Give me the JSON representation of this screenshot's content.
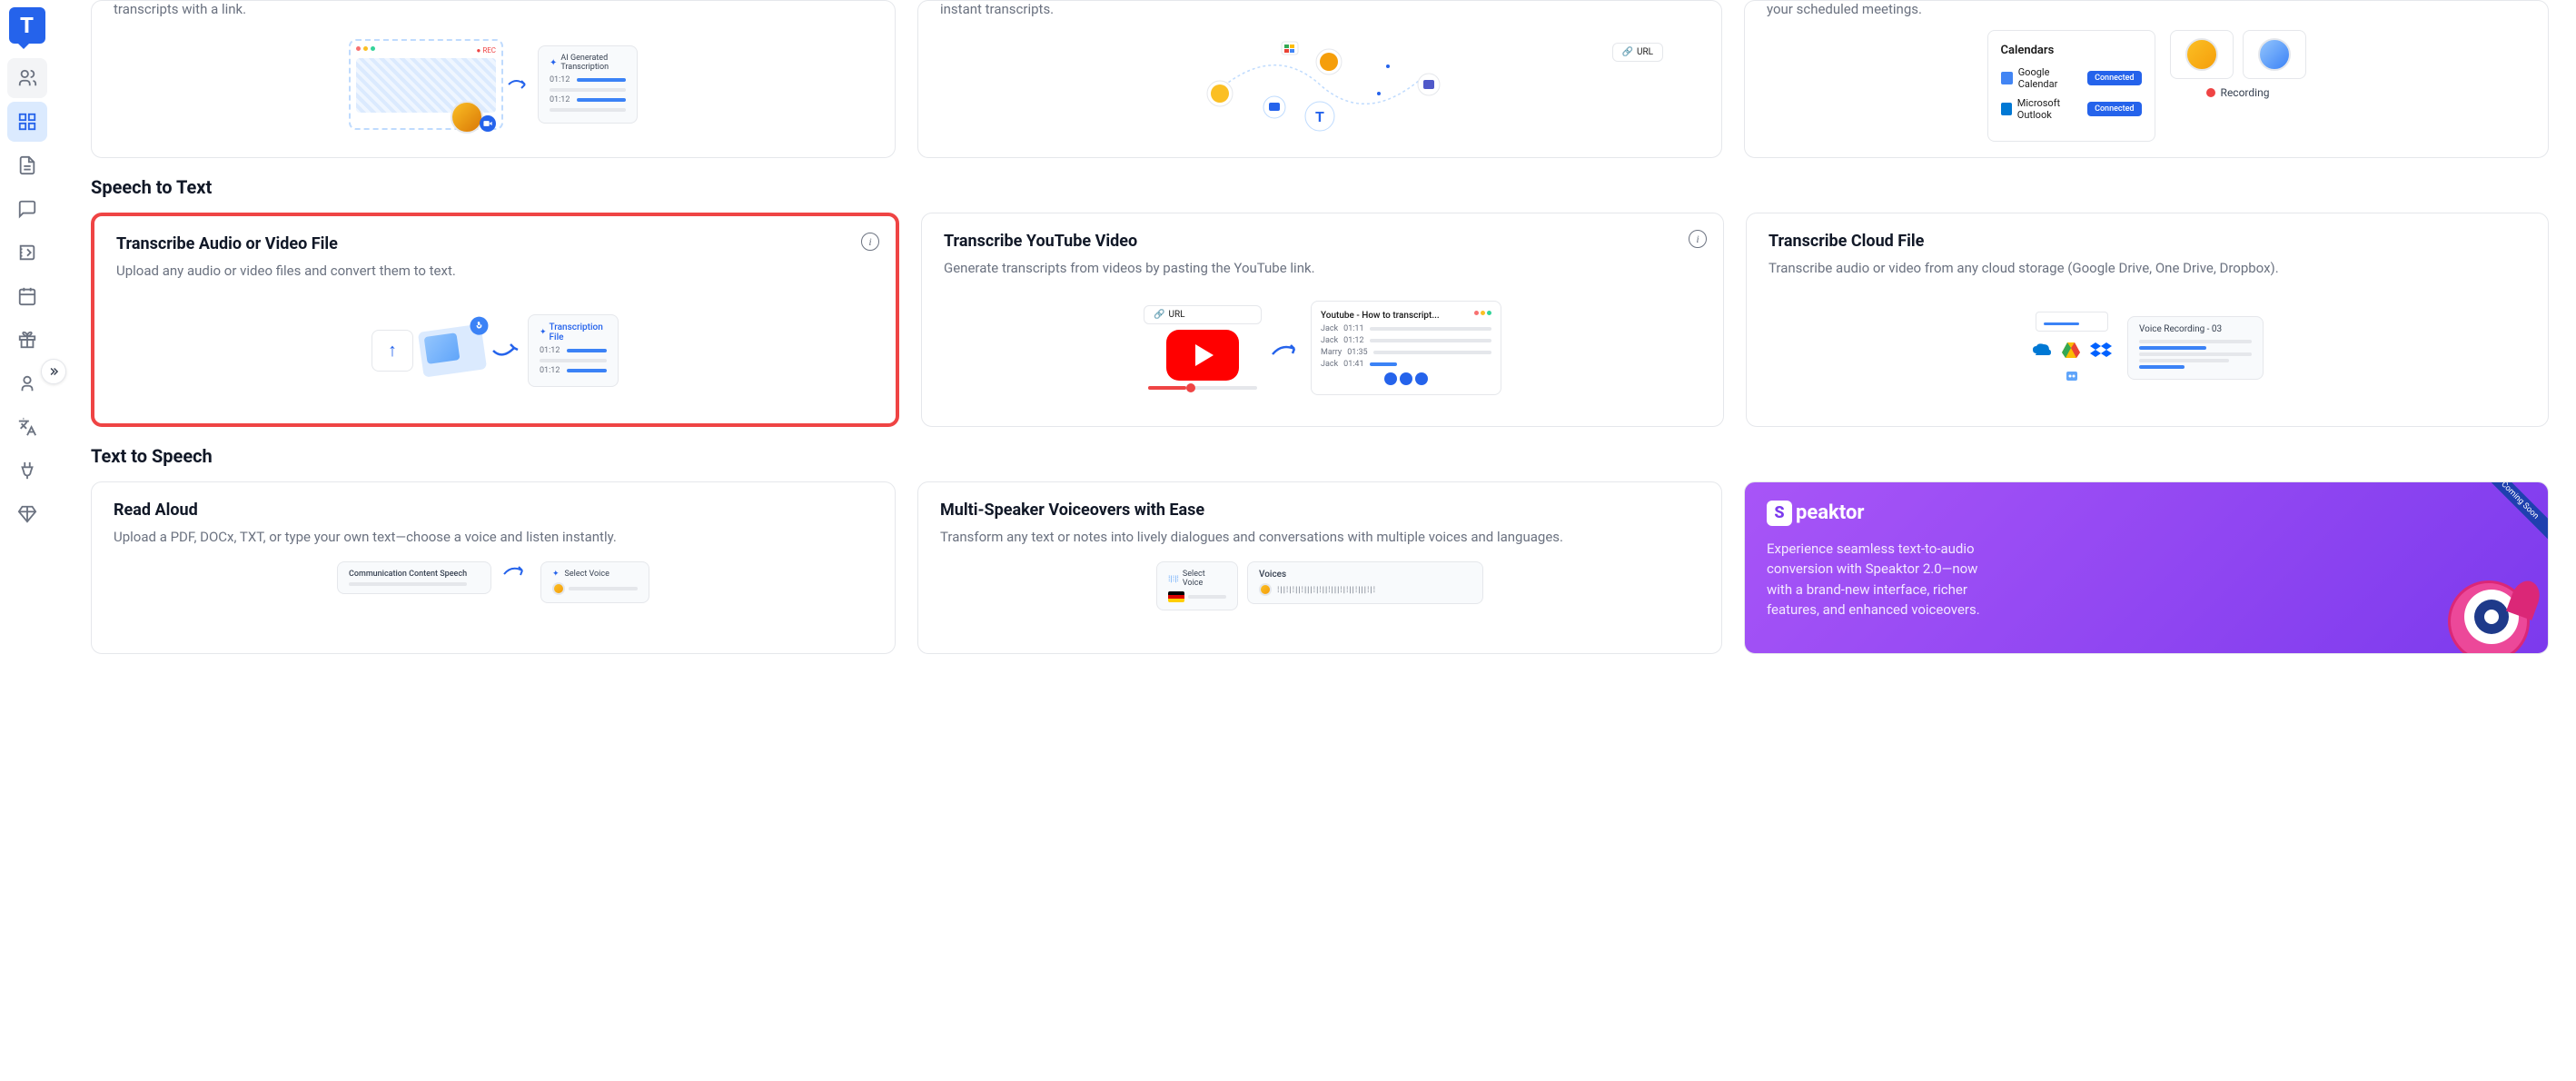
{
  "topRow": {
    "card1_desc": "transcripts with a link.",
    "card2_desc": "instant transcripts.",
    "card3_desc": "your scheduled meetings.",
    "ai_label": "AI Generated Transcription",
    "rec_label": "REC",
    "url_label": "URL",
    "calendars_title": "Calendars",
    "google_cal": "Google Calendar",
    "outlook": "Microsoft Outlook",
    "connected": "Connected",
    "recording": "Recording"
  },
  "speechToText": {
    "title": "Speech to Text",
    "card1": {
      "title": "Transcribe Audio or Video File",
      "desc": "Upload any audio or video files and convert them to text.",
      "trans_file": "Transcription File",
      "t1": "01:12",
      "t2": "01:12"
    },
    "card2": {
      "title": "Transcribe YouTube Video",
      "desc": "Generate transcripts from videos by pasting the YouTube link.",
      "url_label": "URL",
      "yt_title": "Youtube - How to transcript...",
      "s1": "Jack",
      "s1t": "01:11",
      "s2": "Jack",
      "s2t": "01:12",
      "s3": "Marry",
      "s3t": "01:35",
      "s4": "Jack",
      "s4t": "01:41"
    },
    "card3": {
      "title": "Transcribe Cloud File",
      "desc": "Transcribe audio or video from any cloud storage (Google Drive, One Drive, Dropbox).",
      "vr_label": "Voice Recording - 03"
    }
  },
  "textToSpeech": {
    "title": "Text to Speech",
    "card1": {
      "title": "Read Aloud",
      "desc": "Upload a PDF, DOCx, TXT, or type your own text—choose a voice and listen instantly.",
      "comm": "Communication Content Speech",
      "select": "Select Voice"
    },
    "card2": {
      "title": "Multi-Speaker Voiceovers with Ease",
      "desc": "Transform any text or notes into lively dialogues and conversations with multiple voices and languages.",
      "select": "Select Voice",
      "voices": "Voices"
    },
    "card3": {
      "brand": "peaktor",
      "desc": "Experience seamless text-to-audio conversion with Speaktor 2.0—now with a brand-new interface, richer features, and enhanced voiceovers.",
      "badge": "Coming Soon"
    }
  }
}
